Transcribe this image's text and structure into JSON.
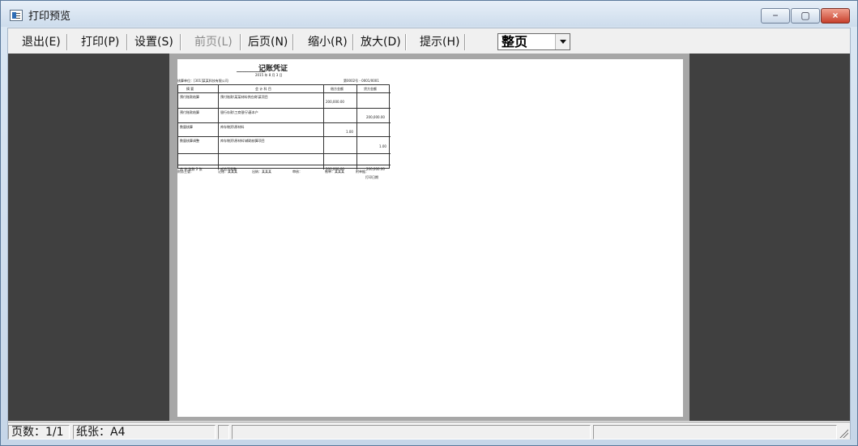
{
  "window": {
    "title": "打印预览",
    "controls": {
      "minimize": "−",
      "maximize": "▢",
      "close": "×"
    }
  },
  "toolbar": {
    "exit": "退出(E)",
    "print": "打印(P)",
    "settings": "设置(S)",
    "prev_page": "前页(L)",
    "next_page": "后页(N)",
    "zoom_out": "缩小(R)",
    "zoom_in": "放大(D)",
    "hint": "提示(H)",
    "zoom_mode": "整页"
  },
  "voucher": {
    "title": "记账凭证",
    "subtitle": "━━━━━━━━━━━━━━━━",
    "date": "2015 年 8 月 3 日",
    "org": "核算单位：[301]某某科技有限公司",
    "voucher_no": "第0002号 - 0001/0001",
    "headers": {
      "summary": "摘 要",
      "account": "会 计 科 目",
      "debit": "借方金额",
      "credit": "贷方金额"
    },
    "rows": [
      {
        "summary": "预付账款结算",
        "account": "预付账款\\某某材料供应商\\某项目",
        "debit": "200,000.00",
        "credit": ""
      },
      {
        "summary": "预付账款结算",
        "account": "银行存款\\工商银行\\基本户",
        "debit": "",
        "credit": "200,000.00"
      },
      {
        "summary": "数量核算",
        "account": "库存物资\\原材料",
        "debit": "1.00",
        "credit": ""
      },
      {
        "summary": "数量核算调整",
        "account": "库存物资\\原材料\\辅助核算项目",
        "debit": "",
        "credit": "1.00"
      }
    ],
    "total_label": "合 计 张数 2 张",
    "total_amount_text": "贰拾万元整",
    "total_debit": "200,000.00",
    "total_credit": "200,000.00",
    "footer": {
      "manager": "财务主管：",
      "bookkeeper": "记账：某某某",
      "cashier": "出纳：某某某",
      "auditor": "审核：",
      "maker": "制单：某某某",
      "attachments": "附单据：",
      "print_mark": "打印日期"
    }
  },
  "status": {
    "pages": "页数：1/1",
    "paper": "纸张：A4"
  }
}
